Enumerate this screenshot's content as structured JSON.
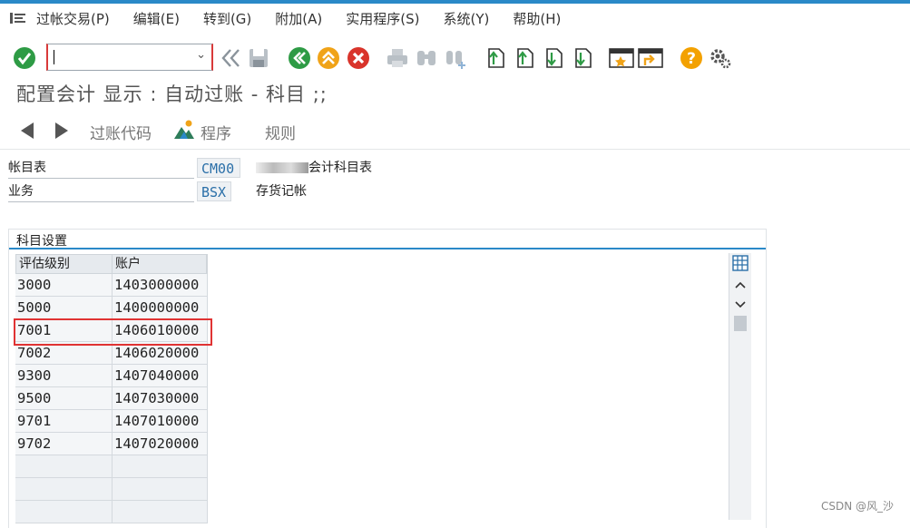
{
  "menu": {
    "items": [
      "过帐交易(P)",
      "编辑(E)",
      "转到(G)",
      "附加(A)",
      "实用程序(S)",
      "系统(Y)",
      "帮助(H)"
    ]
  },
  "toolbar": {
    "command_value": ""
  },
  "page": {
    "title": "配置会计 显示 : 自动过账 - 科目 ;;"
  },
  "app_toolbar": {
    "posting_key": "过账代码",
    "procedure": "程序",
    "rules": "规则"
  },
  "fields": {
    "chart_label": "帐目表",
    "chart_value": "CM00",
    "chart_desc": "会计科目表",
    "transaction_label": "业务",
    "transaction_value": "BSX",
    "transaction_desc": "存货记帐"
  },
  "group": {
    "title": "科目设置",
    "columns": [
      "评估级别",
      "账户"
    ],
    "rows": [
      [
        "3000",
        "1403000000"
      ],
      [
        "5000",
        "1400000000"
      ],
      [
        "7001",
        "1406010000"
      ],
      [
        "7002",
        "1406020000"
      ],
      [
        "9300",
        "1407040000"
      ],
      [
        "9500",
        "1407030000"
      ],
      [
        "9701",
        "1407010000"
      ],
      [
        "9702",
        "1407020000"
      ]
    ]
  },
  "watermark": "CSDN @风_沙",
  "colors": {
    "accent": "#2a89c8",
    "ok_green": "#2e9b45",
    "cancel_red": "#d9342b",
    "exit_orange": "#f0a318",
    "help_orange": "#f3a100",
    "highlight": "#e03333"
  }
}
